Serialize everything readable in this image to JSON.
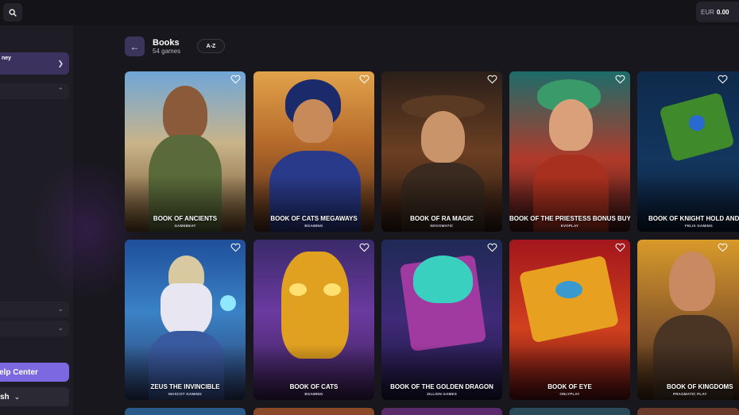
{
  "topbar": {
    "currency": "EUR",
    "amount": "0.00"
  },
  "sidebar": {
    "active_item": "ney",
    "help_label": "elp Center",
    "lang_label": "sh"
  },
  "header": {
    "title": "Books",
    "count": "54 games",
    "sort_label": "A-Z"
  },
  "games": [
    {
      "name": "BOOK OF ANCIENTS",
      "provider": "GAMEBEAT"
    },
    {
      "name": "BOOK OF CATS MEGAWAYS",
      "provider": "BGAMING"
    },
    {
      "name": "BOOK OF RA MAGIC",
      "provider": "NOVOMATIC"
    },
    {
      "name": "BOOK OF THE PRIESTESS BONUS BUY",
      "provider": "EVOPLAY"
    },
    {
      "name": "BOOK OF KNIGHT HOLD AND W",
      "provider": "FELIX GAMING"
    },
    {
      "name": "ZEUS THE INVINCIBLE",
      "provider": "MASCOT GAMING"
    },
    {
      "name": "BOOK OF CATS",
      "provider": "BGAMING"
    },
    {
      "name": "BOOK OF THE GOLDEN DRAGON",
      "provider": "ZILLION GAMES"
    },
    {
      "name": "BOOK OF EYE",
      "provider": "ONLYPLAY"
    },
    {
      "name": "BOOK OF KINGDOMS",
      "provider": "PRAGMATIC PLAY"
    }
  ],
  "icons": {
    "search": "search-icon",
    "back": "arrow-left-icon",
    "favorite": "heart-icon",
    "chevron": "chevron-icon"
  },
  "colors": {
    "accent": "#7c68e0",
    "background": "#18171d",
    "sidebar": "#1e1d25"
  }
}
